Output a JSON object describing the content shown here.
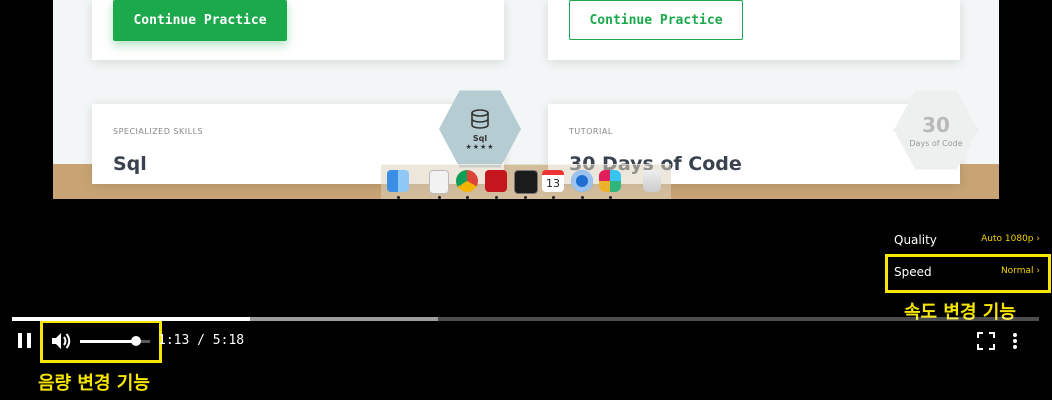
{
  "page": {
    "cards": [
      {
        "button_label": "Continue Practice"
      },
      {
        "button_label": "Continue Practice"
      },
      {
        "subtitle": "SPECIALIZED SKILLS",
        "title": "Sql"
      },
      {
        "subtitle": "TUTORIAL",
        "title": "30 Days of Code"
      }
    ],
    "badges": {
      "sql": {
        "icon": "database-icon",
        "label": "Sql",
        "stars": "★★★★"
      },
      "days": {
        "number": "30",
        "caption": "Days of Code"
      }
    }
  },
  "dock": {
    "apps": [
      "finder-icon",
      "textedit-icon",
      "chrome-icon",
      "acrobat-icon",
      "terminal-icon",
      "calendar-icon",
      "quicktime-icon",
      "slack-icon",
      "trash-icon"
    ],
    "calendar_day": "13"
  },
  "player": {
    "settings_menu": [
      {
        "label": "Quality",
        "value": "Auto 1080p"
      },
      {
        "label": "Speed",
        "value": "Normal"
      }
    ],
    "time_display": "1:13 / 5:18",
    "progress_played": 0.232,
    "progress_buffered": 0.415,
    "volume_level": 0.8,
    "accent": "#f4d100"
  },
  "annotations": {
    "speed": "속도 변경 기능",
    "volume": "음량 변경 기능",
    "highlight_color": "#f6e600"
  }
}
